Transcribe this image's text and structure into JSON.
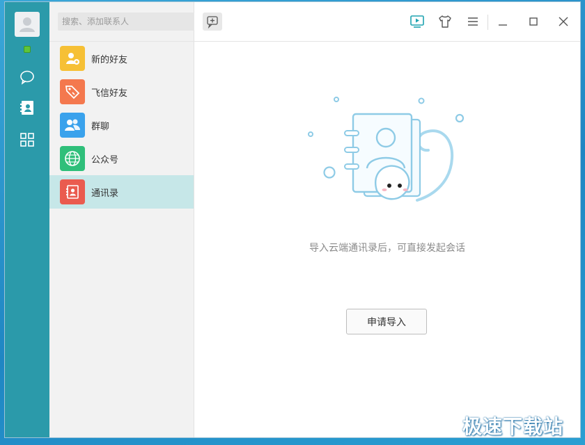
{
  "search": {
    "placeholder": "搜索、添加联系人"
  },
  "contacts": {
    "items": [
      {
        "label": "新的好友",
        "color": "#f6c035"
      },
      {
        "label": "飞信好友",
        "color": "#f4784e"
      },
      {
        "label": "群聊",
        "color": "#3aa2ec"
      },
      {
        "label": "公众号",
        "color": "#2fbf7a"
      },
      {
        "label": "通讯录",
        "color": "#ea5b4f",
        "active": true
      }
    ]
  },
  "nav": {
    "icons": [
      "avatar-icon",
      "chat-icon",
      "contacts-book-icon",
      "apps-grid-icon"
    ],
    "status": "online"
  },
  "titlebar": {
    "icons": [
      "video-icon",
      "skin-tshirt-icon",
      "menu-icon",
      "minimize-icon",
      "maximize-icon",
      "close-icon"
    ]
  },
  "main": {
    "hint": "导入云端通讯录后，可直接发起会话",
    "import_button": "申请导入"
  },
  "watermark": "极速下载站",
  "colors": {
    "nav_bg": "#2b9aaa",
    "accent": "#1ea3b0",
    "active_item": "#c6e7e8"
  }
}
